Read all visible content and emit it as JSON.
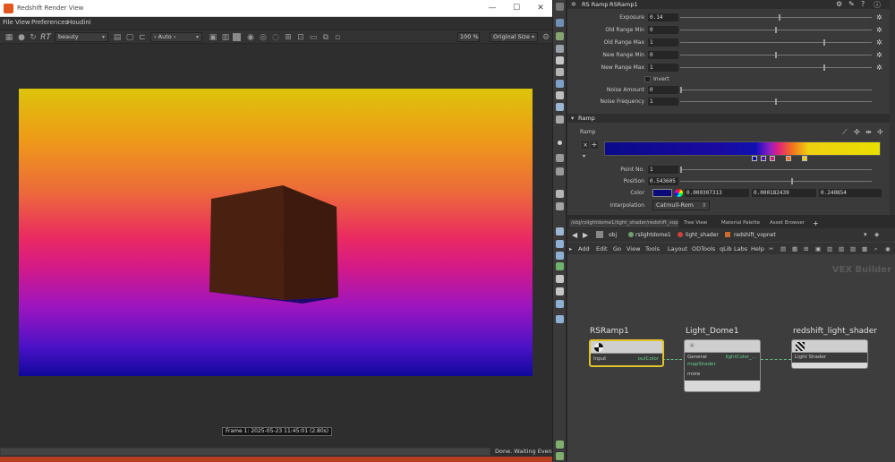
{
  "render_view": {
    "title": "Redshift Render View",
    "window_controls": {
      "minimize": "—",
      "maximize": "☐",
      "close": "✕"
    },
    "menu": [
      "File",
      "View",
      "Preferences",
      "Houdini"
    ],
    "toolbar": {
      "rt_label": "RT",
      "aov": "beauty",
      "camera": "‹ Auto ›",
      "zoom": "100 %",
      "size": "Original Size"
    },
    "frame_label": "Frame 1: 2025-05-23  11:45:01  (2.80s)",
    "status": "Done. Waiting Events",
    "colors": {
      "gradient_top": "#ddc40a",
      "gradient_mid": "#ea2a62",
      "gradient_bottom": "#10089b",
      "cube": "#4a2010"
    }
  },
  "param_pane": {
    "header": {
      "node_type": "RS Ramp",
      "node_name": "RSRamp1"
    },
    "params": [
      {
        "label": "Exposure",
        "value": "0.14"
      },
      {
        "label": "Old Range Min",
        "value": "0"
      },
      {
        "label": "Old Range Max",
        "value": "1"
      },
      {
        "label": "New Range Min",
        "value": "0"
      },
      {
        "label": "New Range Max",
        "value": "1"
      }
    ],
    "invert_label": "Invert",
    "noise": [
      {
        "label": "Noise Amount",
        "value": "0"
      },
      {
        "label": "Noise Frequency",
        "value": "1"
      }
    ],
    "ramp_section": "Ramp",
    "ramp_label": "Ramp",
    "point_no": {
      "label": "Point No.",
      "value": "1"
    },
    "position": {
      "label": "Position",
      "value": "0.543605"
    },
    "color": {
      "label": "Color",
      "r": "0.000307313",
      "g": "0.000182439",
      "b": "0.240854"
    },
    "interpolation": {
      "label": "Interpolation",
      "value": "Catmull-Rom"
    }
  },
  "network_pane": {
    "tabs": [
      "/obj/rslightdome1/light_shader/redshift_vop...",
      "Tree View",
      "Material Palette",
      "Asset Browser",
      "+"
    ],
    "path": [
      "obj",
      "rslightdome1",
      "light_shader",
      "redshift_vopnet"
    ],
    "menu": [
      "Add",
      "Edit",
      "Go",
      "View",
      "Tools",
      "Layout",
      "ODTools",
      "qLib",
      "Labs",
      "Help"
    ],
    "context_label": "VEX Builder",
    "nodes": [
      {
        "title": "RSRamp1",
        "inputs": [
          "Input"
        ],
        "outputs": [
          "outColor"
        ]
      },
      {
        "title": "Light_Dome1",
        "inputs": [
          "General",
          "mapShader",
          "more"
        ],
        "outputs": [
          "lightColor_..."
        ]
      },
      {
        "title": "redshift_light_shader",
        "inputs": [
          "Light Shader"
        ],
        "outputs": []
      }
    ]
  }
}
